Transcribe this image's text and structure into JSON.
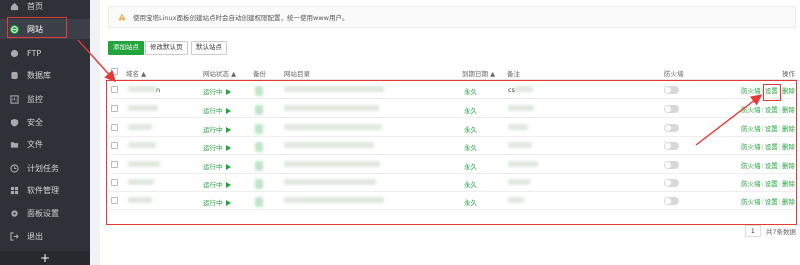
{
  "sidebar": {
    "items": [
      {
        "label": "首页",
        "icon": "home-icon"
      },
      {
        "label": "网站",
        "icon": "globe-icon"
      },
      {
        "label": "FTP",
        "icon": "ftp-icon"
      },
      {
        "label": "数据库",
        "icon": "database-icon"
      },
      {
        "label": "监控",
        "icon": "monitor-icon"
      },
      {
        "label": "安全",
        "icon": "shield-icon"
      },
      {
        "label": "文件",
        "icon": "folder-icon"
      },
      {
        "label": "计划任务",
        "icon": "clock-icon"
      },
      {
        "label": "软件管理",
        "icon": "apps-icon"
      },
      {
        "label": "面板设置",
        "icon": "gear-icon"
      },
      {
        "label": "退出",
        "icon": "logout-icon"
      }
    ],
    "add": "+"
  },
  "notice": "使用宝塔Linux面板创建站点时会自动创建权限配置，统一使用www用户。",
  "toolbar": {
    "add_site": "添加站点",
    "modify_default_page": "修改默认页",
    "default_site": "默认站点"
  },
  "table": {
    "headers": {
      "domain": "域名",
      "status": "网站状态",
      "backup": "备份",
      "root": "网站目录",
      "expiry": "到期日期",
      "note": "备注",
      "firewall": "防火墙",
      "actions": "操作"
    },
    "rows": [
      {
        "domain_tail": "n",
        "status": "运行中",
        "expiry": "永久",
        "note_prefix": "cs"
      },
      {
        "domain_tail": "",
        "status": "运行中",
        "expiry": "永久",
        "note_prefix": ""
      },
      {
        "domain_tail": "",
        "status": "运行中",
        "expiry": "永久",
        "note_prefix": ""
      },
      {
        "domain_tail": "",
        "status": "运行中",
        "expiry": "永久",
        "note_prefix": ""
      },
      {
        "domain_tail": "",
        "status": "运行中",
        "expiry": "永久",
        "note_prefix": ""
      },
      {
        "domain_tail": "",
        "status": "运行中",
        "expiry": "永久",
        "note_prefix": ""
      },
      {
        "domain_tail": "",
        "status": "运行中",
        "expiry": "永久",
        "note_prefix": ""
      }
    ],
    "action_firewall": "防火墙",
    "action_settings": "设置",
    "action_delete": "删除",
    "separator": "|"
  },
  "pagination": {
    "page": "1",
    "total": "共7条数据"
  },
  "colors": {
    "sidebar_bg": "#2e3238",
    "accent_green": "#20a53a",
    "annotation_red": "#e53935"
  }
}
